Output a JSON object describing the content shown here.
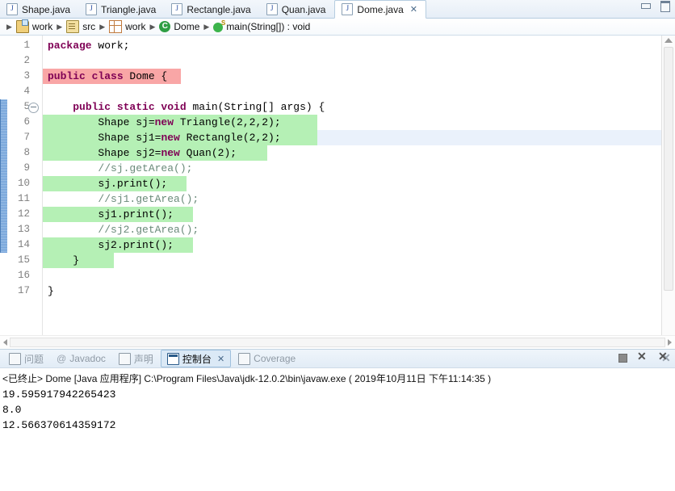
{
  "window": {
    "minimize_label": "Minimize",
    "maximize_label": "Maximize"
  },
  "editor_tabs": [
    {
      "label": "Shape.java",
      "icon": "java-file-icon",
      "active": false
    },
    {
      "label": "Triangle.java",
      "icon": "java-file-icon",
      "active": false
    },
    {
      "label": "Rectangle.java",
      "icon": "java-file-icon",
      "active": false
    },
    {
      "label": "Quan.java",
      "icon": "java-file-icon",
      "active": false
    },
    {
      "label": "Dome.java",
      "icon": "java-file-icon",
      "active": true,
      "close_glyph": "✕"
    }
  ],
  "breadcrumb": {
    "separator": "▶",
    "items": [
      {
        "label": "work",
        "icon": "project-folder-icon"
      },
      {
        "label": "src",
        "icon": "source-folder-icon"
      },
      {
        "label": "work",
        "icon": "package-icon"
      },
      {
        "label": "Dome",
        "icon": "class-icon"
      },
      {
        "label": "main(String[]) : void",
        "icon": "method-icon"
      }
    ]
  },
  "editor": {
    "lines": [
      {
        "num": "1",
        "fold": false,
        "highlight": "none",
        "hl_width": 0,
        "tokens": [
          {
            "t": "package",
            "c": "kw"
          },
          {
            "t": " work;",
            "c": "pln"
          }
        ]
      },
      {
        "num": "2",
        "fold": false,
        "highlight": "none",
        "hl_width": 0,
        "tokens": []
      },
      {
        "num": "3",
        "fold": false,
        "highlight": "occur",
        "hl_width": 171,
        "tokens": [
          {
            "t": "public class",
            "c": "kw"
          },
          {
            "t": " Dome {",
            "c": "pln"
          }
        ]
      },
      {
        "num": "4",
        "fold": false,
        "highlight": "none",
        "hl_width": 0,
        "tokens": []
      },
      {
        "num": "5",
        "fold": true,
        "highlight": "none",
        "hl_width": 0,
        "tokens": [
          {
            "t": "    ",
            "c": "pln"
          },
          {
            "t": "public static void",
            "c": "kw"
          },
          {
            "t": " main(String[] args) {",
            "c": "pln"
          }
        ]
      },
      {
        "num": "6",
        "fold": false,
        "highlight": "green",
        "hl_width": 340,
        "tokens": [
          {
            "t": "        Shape sj=",
            "c": "pln"
          },
          {
            "t": "new",
            "c": "kw"
          },
          {
            "t": " Triangle(2,2,2);",
            "c": "pln"
          }
        ]
      },
      {
        "num": "7",
        "fold": false,
        "highlight": "green-current",
        "hl_width": 340,
        "tokens": [
          {
            "t": "        Shape sj1=",
            "c": "pln"
          },
          {
            "t": "new",
            "c": "kw"
          },
          {
            "t": " Rectangle(2,2);",
            "c": "pln"
          }
        ]
      },
      {
        "num": "8",
        "fold": false,
        "highlight": "green",
        "hl_width": 278,
        "tokens": [
          {
            "t": "        Shape sj2=",
            "c": "pln"
          },
          {
            "t": "new",
            "c": "kw"
          },
          {
            "t": " Quan(2);",
            "c": "pln"
          }
        ]
      },
      {
        "num": "9",
        "fold": false,
        "highlight": "none",
        "hl_width": 0,
        "tokens": [
          {
            "t": "        //sj.getArea();",
            "c": "cmt"
          }
        ]
      },
      {
        "num": "10",
        "fold": false,
        "highlight": "green",
        "hl_width": 178,
        "tokens": [
          {
            "t": "        sj.print();",
            "c": "pln"
          }
        ]
      },
      {
        "num": "11",
        "fold": false,
        "highlight": "none",
        "hl_width": 0,
        "tokens": [
          {
            "t": "        //sj1.getArea();",
            "c": "cmt"
          }
        ]
      },
      {
        "num": "12",
        "fold": false,
        "highlight": "green",
        "hl_width": 186,
        "tokens": [
          {
            "t": "        sj1.print();",
            "c": "pln"
          }
        ]
      },
      {
        "num": "13",
        "fold": false,
        "highlight": "none",
        "hl_width": 0,
        "tokens": [
          {
            "t": "        //sj2.getArea();",
            "c": "cmt"
          }
        ]
      },
      {
        "num": "14",
        "fold": false,
        "highlight": "green",
        "hl_width": 186,
        "tokens": [
          {
            "t": "        sj2.print();",
            "c": "pln"
          }
        ]
      },
      {
        "num": "15",
        "fold": false,
        "highlight": "green",
        "hl_width": 88,
        "tokens": [
          {
            "t": "    }",
            "c": "pln"
          }
        ]
      },
      {
        "num": "16",
        "fold": false,
        "highlight": "none",
        "hl_width": 0,
        "tokens": []
      },
      {
        "num": "17",
        "fold": false,
        "highlight": "none",
        "hl_width": 0,
        "tokens": [
          {
            "t": "}",
            "c": "pln"
          }
        ]
      }
    ],
    "colors": {
      "keyword": "#7f0055",
      "comment": "#6a8a7a",
      "occurrence_highlight": "#f9a6a6",
      "diff_highlight": "#b5f0b5",
      "current_line": "#eaf1fb"
    }
  },
  "panel_tabs": [
    {
      "label": "问题",
      "icon": "problems-icon",
      "active": false
    },
    {
      "label": "Javadoc",
      "icon": "javadoc-icon",
      "active": false
    },
    {
      "label": "声明",
      "icon": "declaration-icon",
      "active": false
    },
    {
      "label": "控制台",
      "icon": "console-icon",
      "active": true,
      "close_glyph": "✕"
    },
    {
      "label": "Coverage",
      "icon": "coverage-icon",
      "active": false
    }
  ],
  "panel_tools": [
    {
      "name": "terminate-button",
      "glyph": "■"
    },
    {
      "name": "remove-launch-button",
      "glyph": "✕"
    },
    {
      "name": "remove-all-terminated-button",
      "glyph": "✕"
    }
  ],
  "console": {
    "status_line": "<已终止> Dome [Java 应用程序] C:\\Program Files\\Java\\jdk-12.0.2\\bin\\javaw.exe ( 2019年10月11日 下午11:14:35 )",
    "output_lines": [
      "19.595917942265423",
      "8.0",
      "12.566370614359172"
    ]
  }
}
